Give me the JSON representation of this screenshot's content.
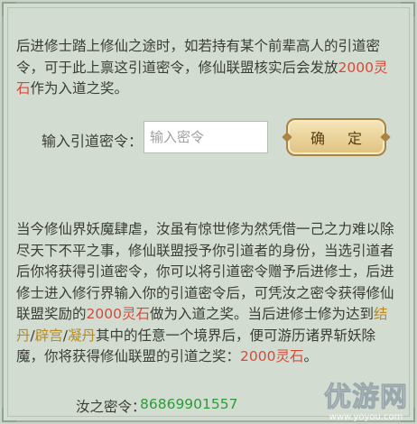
{
  "intro": {
    "line1": "后进修士踏上修仙之途时，如若持有某个前辈高人的引道密",
    "line2": "令，可于此上禀这引道密令，修仙联盟核实后会发放",
    "reward_a": "2000灵",
    "reward_b": "石",
    "line3_rest": "作为入道之奖。"
  },
  "form": {
    "label": "输入引道密令：",
    "placeholder": "输入密令",
    "confirm": "确 定"
  },
  "body": {
    "line1": "当今修仙界妖魔肆虐，汝虽有惊世修为然凭借一己之力难以除",
    "line2": "尽天下不平之事，修仙联盟授予你引道者的身份，当选引道者",
    "line3": "后你将获得引道密令，你可以将引道密令赠予后进修士，后进",
    "line4": "修士进入修行界输入你的引道密令后，可凭汝之密令获得修仙",
    "line5_a": "联盟奖励的",
    "line5_reward": "2000灵石",
    "line5_b": "做为入道之奖。当后进修士修为达到",
    "realm1_a": "结",
    "realm1_b": "丹",
    "sep1": "/",
    "realm2": "辟宫",
    "sep2": "/",
    "realm3": "凝丹",
    "line6_rest": "其中的任意一个境界后，便可游历诸界斩妖除",
    "line7_a": "魔，你将获得修仙联盟的引道之奖：",
    "line7_reward": "2000灵石",
    "line7_b": "。"
  },
  "my_code": {
    "label": "汝之密令：",
    "value": "86869901557"
  },
  "watermark": {
    "text": "优游网",
    "url": "www.yoyou.com"
  },
  "colors": {
    "background": "#d3dcd1",
    "highlight_red": "#d64a3a",
    "highlight_gold": "#b98a1d",
    "code_green": "#2f9a3a",
    "button_gold": "#dfc27f"
  }
}
